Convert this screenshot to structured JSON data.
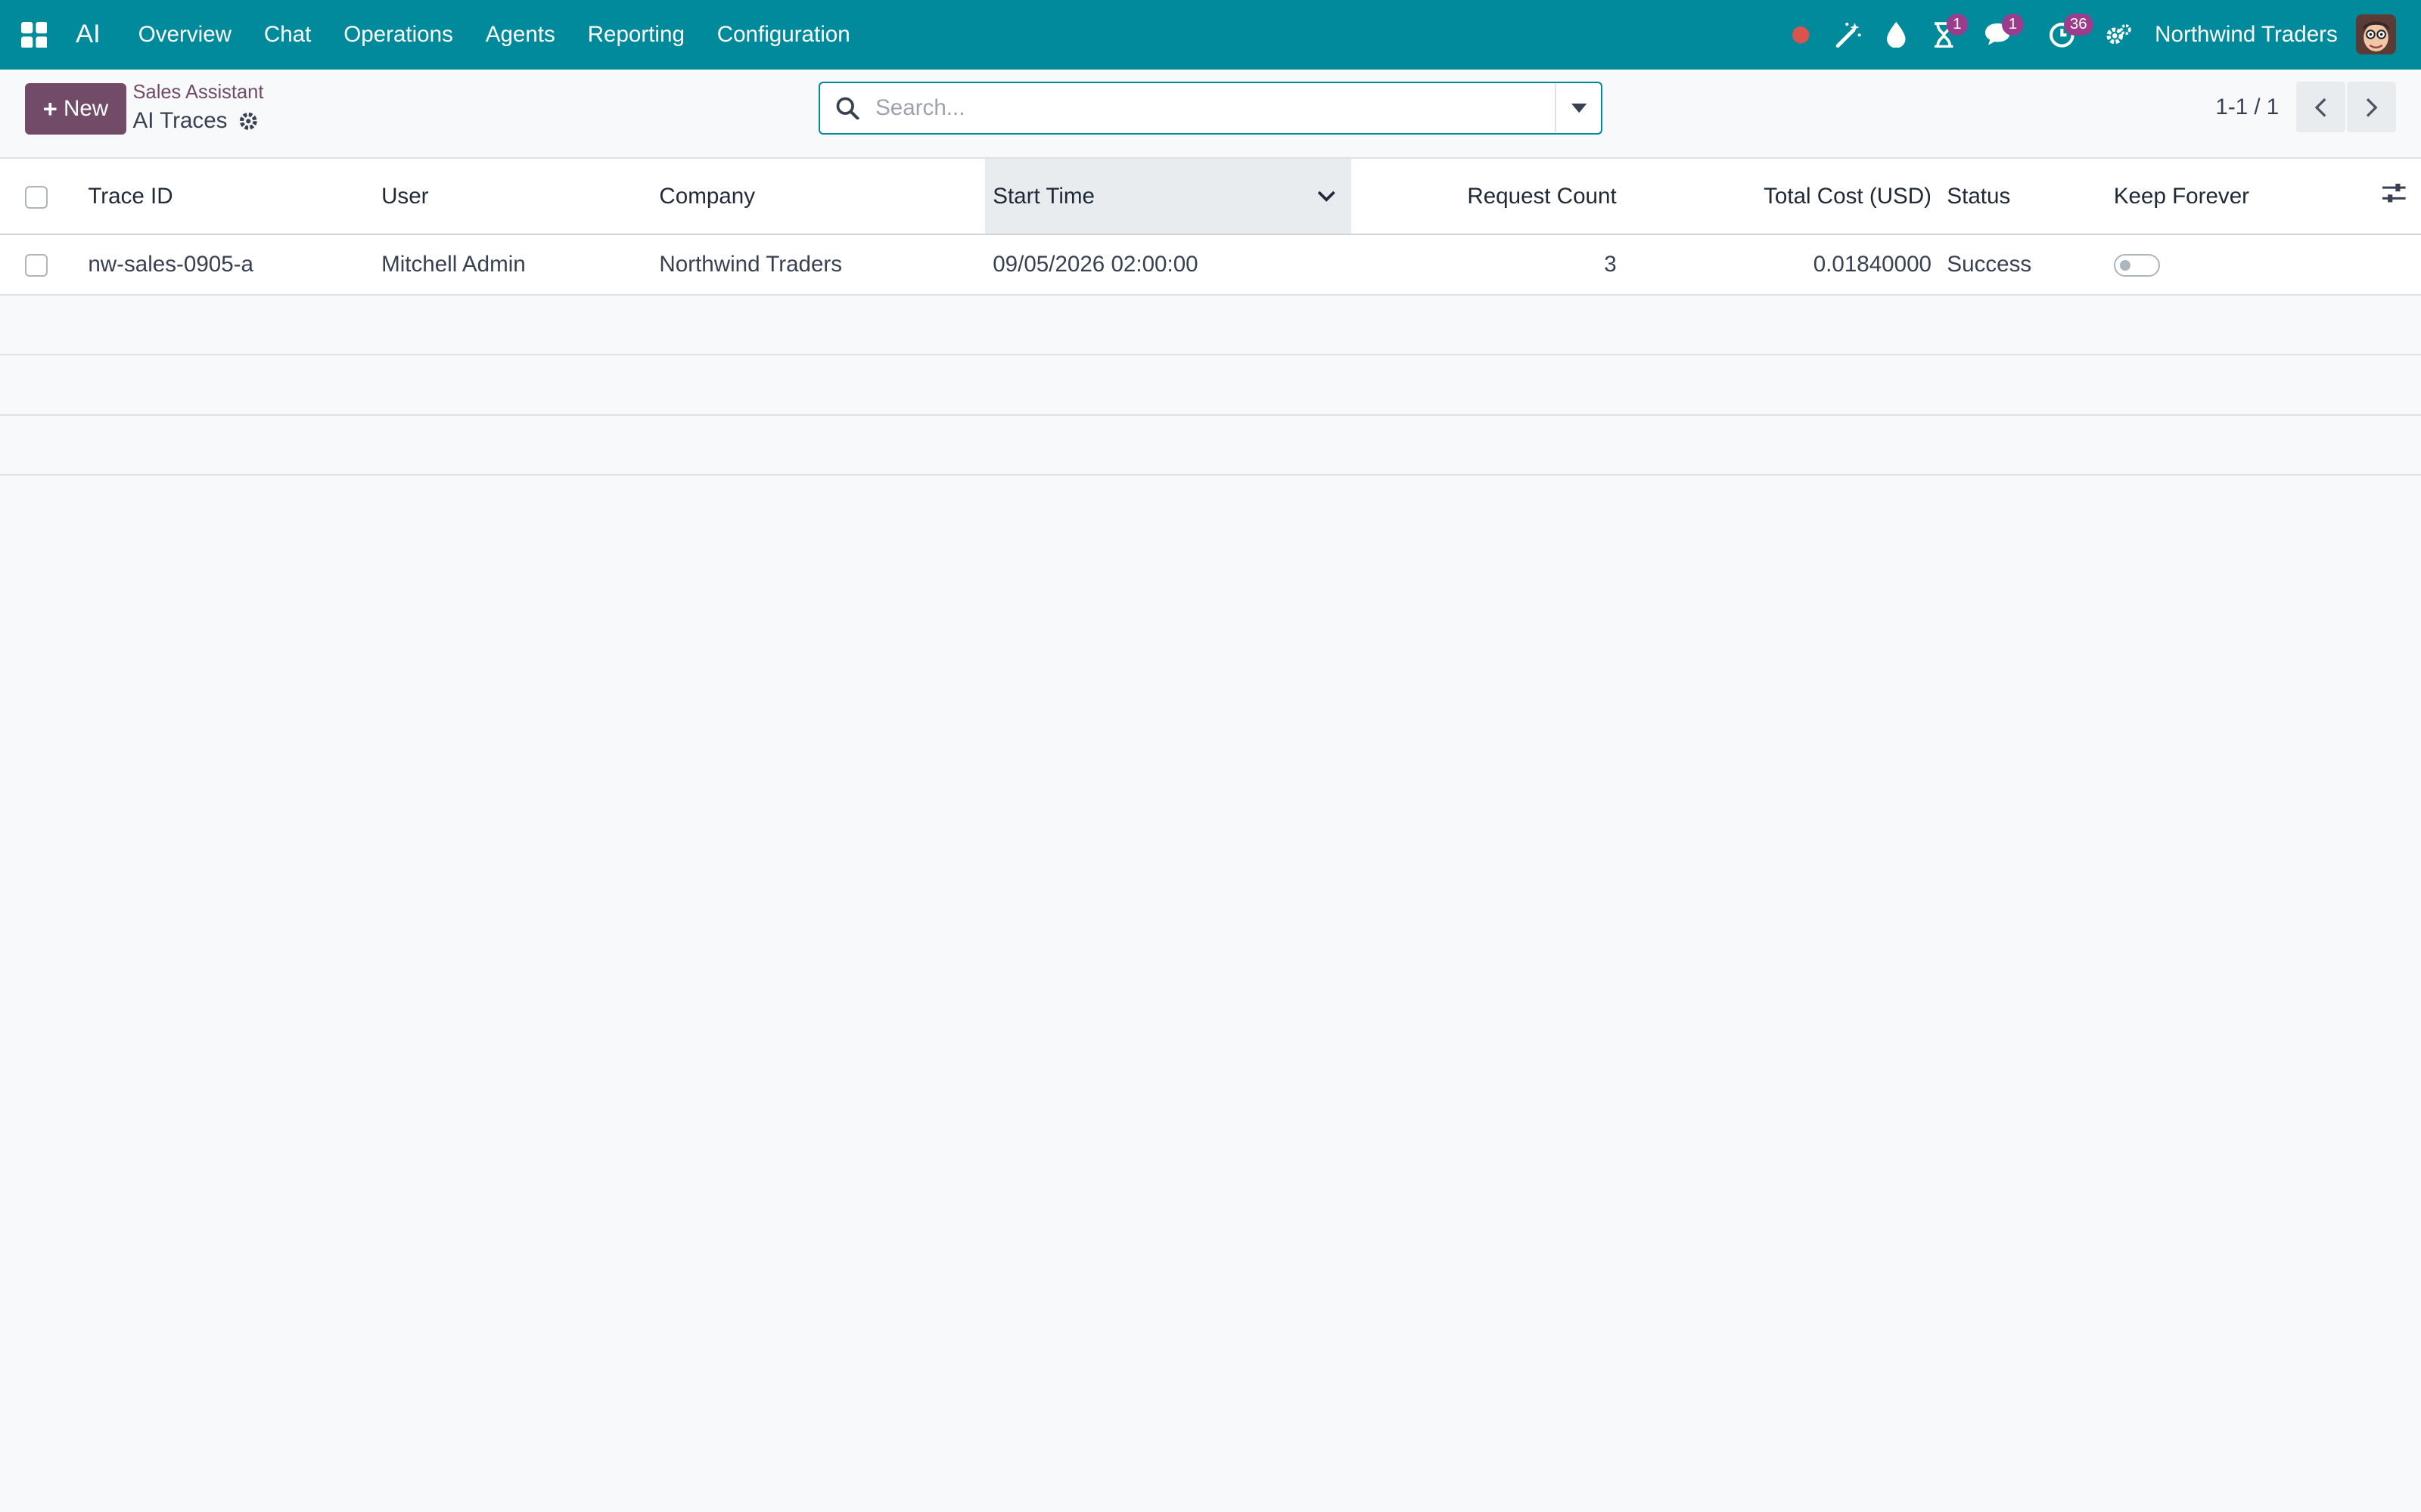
{
  "navbar": {
    "apps_icon": "grid-apps-icon",
    "brand": "AI",
    "menu": [
      "Overview",
      "Chat",
      "Operations",
      "Agents",
      "Reporting",
      "Configuration"
    ],
    "systray": {
      "messaging_badge": "1",
      "chat_badge": "1",
      "activity_badge": "36"
    },
    "company": "Northwind Traders",
    "colors": {
      "bar": "#018a9b",
      "badge": "#9b3d8c",
      "recording": "#d9534f"
    }
  },
  "control_panel": {
    "new_label": "New",
    "breadcrumb_parent": "Sales Assistant",
    "breadcrumb_current": "AI Traces",
    "search_placeholder": "Search...",
    "pager_value": "1-1 / 1",
    "accent": "#714b67"
  },
  "table": {
    "headers": {
      "trace_id": "Trace ID",
      "user": "User",
      "company": "Company",
      "start_time": "Start Time",
      "request_count": "Request Count",
      "total_cost": "Total Cost (USD)",
      "status": "Status",
      "keep_forever": "Keep Forever"
    },
    "rows": [
      {
        "trace_id": "nw-sales-0905-a",
        "user": "Mitchell Admin",
        "company": "Northwind Traders",
        "start_time": "09/05/2026 02:00:00",
        "request_count": "3",
        "total_cost": "0.01840000",
        "status": "Success",
        "keep_forever": false
      }
    ]
  }
}
